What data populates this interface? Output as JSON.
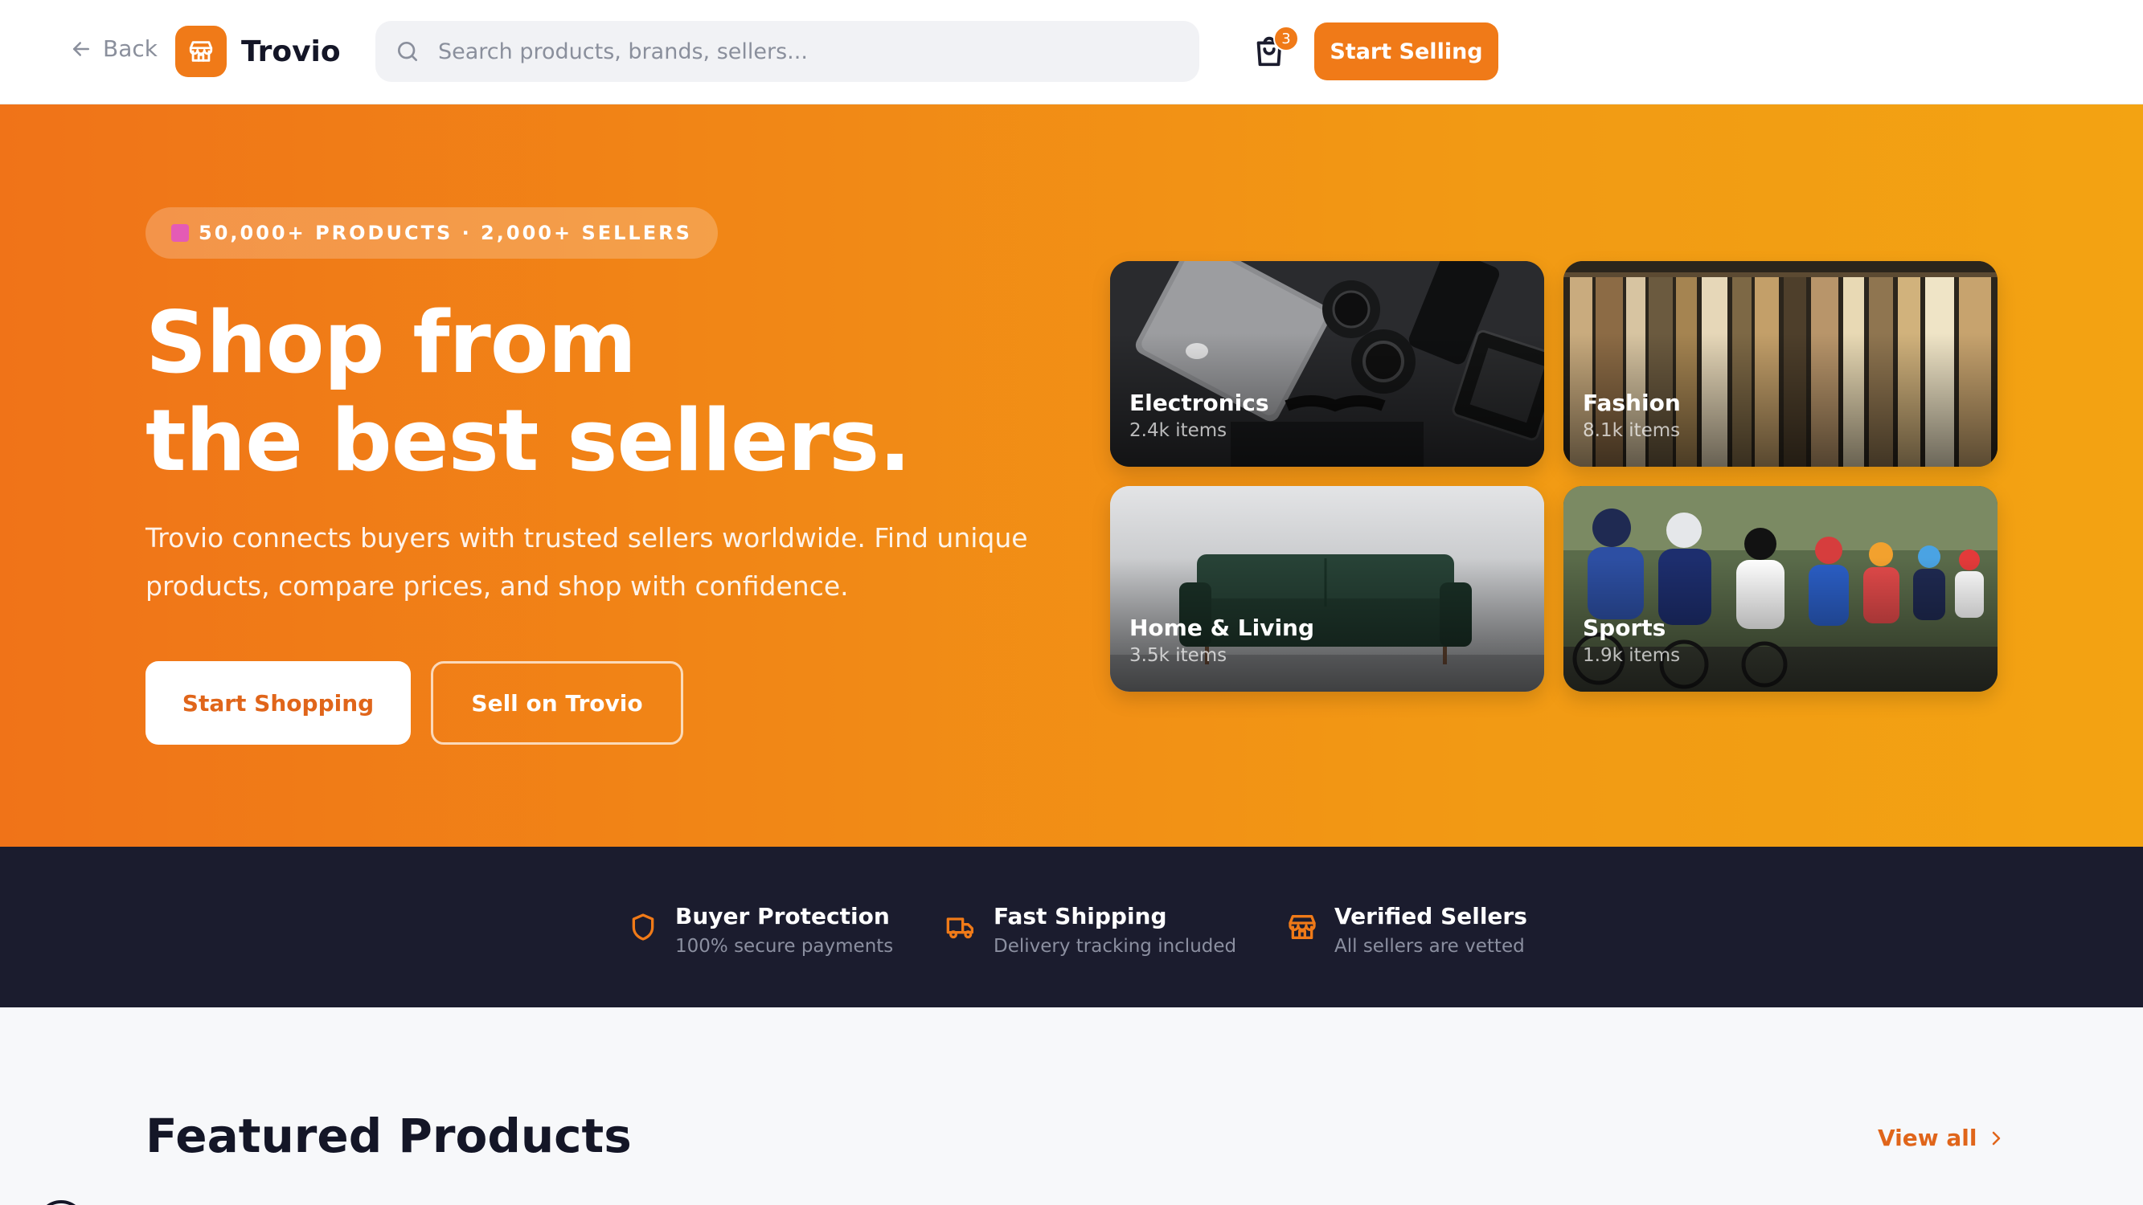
{
  "header": {
    "back_label": "Back",
    "brand_name": "Trovio",
    "search_placeholder": "Search products, brands, sellers...",
    "cart_count": "3",
    "start_selling_label": "Start Selling"
  },
  "hero": {
    "badge": "50,000+ PRODUCTS · 2,000+ SELLERS",
    "title_line1": "Shop from",
    "title_line2": "the best sellers.",
    "subtitle": "Trovio connects buyers with trusted sellers worldwide. Find unique products, compare prices, and shop with confidence.",
    "primary_cta": "Start Shopping",
    "secondary_cta": "Sell on Trovio",
    "categories": [
      {
        "name": "Electronics",
        "count": "2.4k items"
      },
      {
        "name": "Fashion",
        "count": "8.1k items"
      },
      {
        "name": "Home & Living",
        "count": "3.5k items"
      },
      {
        "name": "Sports",
        "count": "1.9k items"
      }
    ]
  },
  "features": [
    {
      "title": "Buyer Protection",
      "subtitle": "100% secure payments",
      "icon": "shield-icon"
    },
    {
      "title": "Fast Shipping",
      "subtitle": "Delivery tracking included",
      "icon": "truck-icon"
    },
    {
      "title": "Verified Sellers",
      "subtitle": "All sellers are vetted",
      "icon": "store-icon"
    }
  ],
  "featured": {
    "title": "Featured Products",
    "view_all": "View all"
  },
  "colors": {
    "accent": "#f07a18",
    "hero_start": "#f07318",
    "hero_end": "#f3a312",
    "dark": "#1b1c2e"
  }
}
